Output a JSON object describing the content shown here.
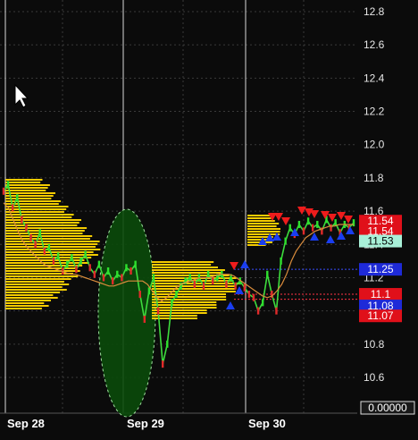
{
  "chart_data": {
    "type": "line",
    "title": "",
    "xlabel": "",
    "ylabel": "",
    "ylim": [
      10.52,
      12.86
    ],
    "y_ticks": [
      "12.8",
      "12.6",
      "12.4",
      "12.2",
      "12.0",
      "11.8",
      "11.6",
      "11.4",
      "11.2",
      "11.0",
      "10.8",
      "10.6"
    ],
    "x_tick_labels": [
      "Sep 28",
      "Sep 29",
      "Sep 30"
    ],
    "grid": true,
    "series": [
      {
        "values": [
          11.72,
          11.76,
          11.62,
          11.68,
          11.55,
          11.5,
          11.44,
          11.4,
          11.47,
          11.36,
          11.38,
          11.3,
          11.33,
          11.24,
          11.28,
          11.32,
          11.25,
          11.3,
          11.34,
          11.26,
          11.22,
          11.28,
          11.2,
          11.24,
          11.18,
          11.22,
          11.2,
          11.26,
          11.24,
          11.28,
          11.1,
          10.95,
          11.12,
          11.2,
          11.0,
          10.68,
          10.8,
          11.05,
          11.1,
          11.15,
          11.18,
          11.2,
          11.16,
          11.2,
          11.15,
          11.22,
          11.18,
          11.2,
          11.22,
          11.16,
          11.2,
          11.15,
          11.18,
          11.14,
          11.1,
          11.08,
          11.0,
          11.05,
          11.22,
          11.1,
          11.0,
          11.3,
          11.42,
          11.5,
          11.46,
          11.52,
          11.48,
          11.54,
          11.5,
          11.52,
          11.48,
          11.55,
          11.5,
          11.53,
          11.47,
          11.52,
          11.5,
          11.53
        ],
        "color": "#3ddc3d"
      },
      {
        "values": [
          11.65,
          11.62,
          11.55,
          11.48,
          11.42,
          11.38,
          11.35,
          11.32,
          11.29,
          11.27,
          11.26,
          11.25,
          11.24,
          11.23,
          11.22,
          11.22,
          11.21,
          11.2,
          11.19,
          11.18,
          11.17,
          11.16,
          11.15,
          11.15,
          11.16,
          11.17,
          11.18,
          11.18,
          11.18,
          11.18,
          11.16,
          11.12,
          11.08,
          11.06,
          11.08,
          11.11,
          11.14,
          11.16,
          11.17,
          11.18,
          11.19,
          11.2,
          11.2,
          11.2,
          11.21,
          11.22,
          11.22,
          11.22,
          11.21,
          11.19,
          11.17,
          11.15,
          11.13,
          11.11,
          11.09,
          11.08,
          11.09,
          11.12,
          11.16,
          11.22,
          11.3,
          11.36,
          11.4,
          11.44,
          11.46,
          11.48,
          11.49,
          11.5,
          11.51,
          11.51,
          11.52,
          11.52,
          11.52,
          11.52
        ],
        "color": "#d98c3c"
      }
    ],
    "price_labels": [
      {
        "text": "11.54",
        "value": 11.54,
        "bg": "#e0101a",
        "fg": "#ffffff"
      },
      {
        "text": "11.54",
        "value": 11.48,
        "bg": "#e0101a",
        "fg": "#ffffff"
      },
      {
        "text": "11.53",
        "value": 11.42,
        "bg": "#a8f0d8",
        "fg": "#000000"
      },
      {
        "text": "11.25",
        "value": 11.25,
        "bg": "#1e2ad8",
        "fg": "#ffffff"
      },
      {
        "text": "11.1",
        "value": 11.1,
        "bg": "#e0101a",
        "fg": "#ffffff"
      },
      {
        "text": "11.08",
        "value": 11.03,
        "bg": "#1e2ad8",
        "fg": "#ffffff"
      },
      {
        "text": "11.07",
        "value": 10.97,
        "bg": "#e0101a",
        "fg": "#ffffff"
      }
    ],
    "reference_lines": [
      {
        "value": 11.25,
        "color": "#3a4cff"
      },
      {
        "value": 11.1,
        "color": "#ff3344"
      },
      {
        "value": 11.07,
        "color": "#ff3344"
      }
    ],
    "indicator_readout": "0.00000",
    "colors": {
      "background": "#0b0b0b",
      "grid": "#3a3a3a",
      "volume_profile": "#f5cc00",
      "highlight_ellipse": "#0a4a0a",
      "up_arrow": "#1a3ef0",
      "down_arrow": "#ee1c1c"
    }
  },
  "icons": {
    "cursor": "mouse-pointer-icon"
  }
}
